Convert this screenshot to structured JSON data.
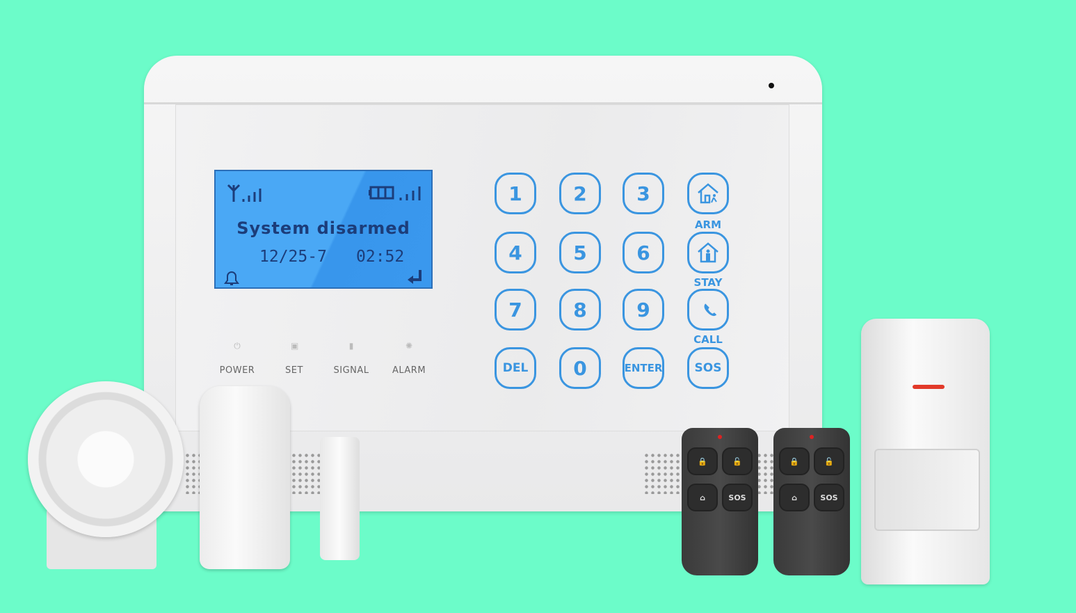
{
  "colors": {
    "background": "#6cfcc9",
    "lcd": "#4aa8f5",
    "key_accent": "#3a95e0",
    "lcd_text": "#1c3d7a"
  },
  "lcd": {
    "message": "System disarmed",
    "date": "12/25-7",
    "time": "02:52",
    "icons": [
      "antenna-signal-icon",
      "battery-icon",
      "signal-bars-icon",
      "bell-icon",
      "enter-arrow-icon"
    ]
  },
  "keypad": {
    "keys": [
      "1",
      "2",
      "3",
      "4",
      "5",
      "6",
      "7",
      "8",
      "9",
      "DEL",
      "0",
      "ENTER",
      "SOS"
    ],
    "function_labels": {
      "arm": "ARM",
      "stay": "STAY",
      "call": "CALL"
    }
  },
  "indicators": [
    {
      "label": "POWER"
    },
    {
      "label": "SET"
    },
    {
      "label": "SIGNAL"
    },
    {
      "label": "ALARM"
    }
  ],
  "remote": {
    "sos_label": "SOS"
  }
}
